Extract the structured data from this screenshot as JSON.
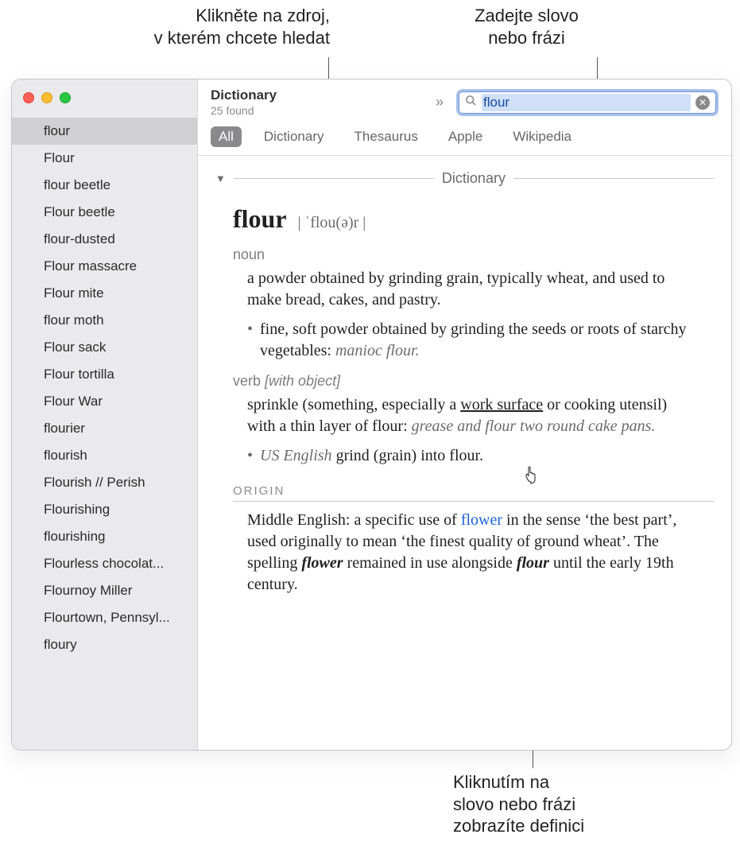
{
  "callouts": {
    "source": "Klikněte na zdroj,\nv kterém chcete hledat",
    "search": "Zadejte slovo\nnebo frázi",
    "define": "Kliknutím na\nslovo nebo frázi\nzobrazíte definici"
  },
  "window": {
    "title": "Dictionary",
    "subtitle": "25 found"
  },
  "search": {
    "value": "flour",
    "placeholder": ""
  },
  "tabs": [
    "All",
    "Dictionary",
    "Thesaurus",
    "Apple",
    "Wikipedia"
  ],
  "sidebar": {
    "items": [
      "flour",
      "Flour",
      "flour beetle",
      "Flour beetle",
      "flour-dusted",
      "Flour massacre",
      "Flour mite",
      "flour moth",
      "Flour sack",
      "Flour tortilla",
      "Flour War",
      "flourier",
      "flourish",
      "Flourish // Perish",
      "Flourishing",
      "flourishing",
      "Flourless chocolat...",
      "Flournoy Miller",
      "Flourtown, Pennsyl...",
      "floury"
    ]
  },
  "entry": {
    "section_title": "Dictionary",
    "word": "flour",
    "pronunciation": "| ˈflou(ə)r |",
    "pos_noun": "noun",
    "def_noun": "a powder obtained by grinding grain, typically wheat, and used to make bread, cakes, and pastry",
    "sub_noun": "fine, soft powder obtained by grinding the seeds or roots of starchy vegetables",
    "sub_noun_example": "manioc flour.",
    "pos_verb": "verb",
    "pos_verb_note": "[with object]",
    "def_verb_a": "sprinkle (something, especially a ",
    "def_verb_link": "work surface",
    "def_verb_b": " or cooking utensil) with a thin layer of flour",
    "def_verb_example": "grease and flour two round cake pans.",
    "sub_verb_prefix": "US English",
    "sub_verb": "grind (grain) into flour",
    "origin_label": "ORIGIN",
    "origin_a": "Middle English: a specific use of ",
    "origin_link": "flower",
    "origin_b": " in the sense ‘the best part’, used originally to mean ‘the finest quality of ground wheat’. The spelling ",
    "origin_c": "flower",
    "origin_d": " remained in use alongside ",
    "origin_e": "flour",
    "origin_f": " until the early 19th century."
  }
}
